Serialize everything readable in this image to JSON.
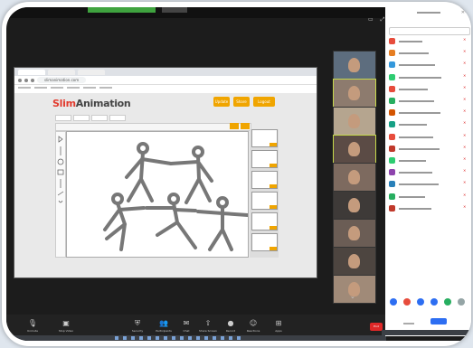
{
  "app": {
    "logo_prefix": "Slim",
    "logo_suffix": "Animation",
    "colors": {
      "accent": "#f0a500",
      "logo_red": "#e23b2e",
      "zoom_bg": "#1c1c1c",
      "end_red": "#e02828",
      "link_blue": "#2d6ef2"
    }
  },
  "browser": {
    "url": "slimanimation.com",
    "header_buttons": [
      "Update",
      "Share",
      "Logout"
    ]
  },
  "toolbar": {
    "tiny_buttons": [
      "Undo",
      "Redo"
    ]
  },
  "zoom_toolbar": {
    "buttons": [
      {
        "icon": "mic-icon",
        "glyph": "🎙",
        "label": "Unmute"
      },
      {
        "icon": "video-icon",
        "glyph": "▣",
        "label": "Stop Video"
      },
      {
        "icon": "security-icon",
        "glyph": "⛨",
        "label": "Security"
      },
      {
        "icon": "participants-icon",
        "glyph": "👥",
        "label": "Participants"
      },
      {
        "icon": "chat-icon",
        "glyph": "✉",
        "label": "Chat"
      },
      {
        "icon": "share-icon",
        "glyph": "⇧",
        "label": "Share Screen"
      },
      {
        "icon": "record-icon",
        "glyph": "●",
        "label": "Record"
      },
      {
        "icon": "reactions-icon",
        "glyph": "☺",
        "label": "Reactions"
      },
      {
        "icon": "apps-icon",
        "glyph": "⊞",
        "label": "Apps"
      }
    ],
    "end_label": "End"
  },
  "panel": {
    "participants": [
      {
        "color": "#e74c3c"
      },
      {
        "color": "#e67e22"
      },
      {
        "color": "#3498db"
      },
      {
        "color": "#2ecc71"
      },
      {
        "color": "#e74c3c"
      },
      {
        "color": "#27ae60"
      },
      {
        "color": "#d35400"
      },
      {
        "color": "#16a085"
      },
      {
        "color": "#e74c3c"
      },
      {
        "color": "#c0392b"
      },
      {
        "color": "#2ecc71"
      },
      {
        "color": "#8e44ad"
      },
      {
        "color": "#2980b9"
      },
      {
        "color": "#27ae60"
      },
      {
        "color": "#c0392b"
      }
    ],
    "bottom_buttons": [
      {
        "color": "#2d6ef2"
      },
      {
        "color": "#e74c3c"
      },
      {
        "color": "#2d6ef2"
      },
      {
        "color": "#2d6ef2"
      },
      {
        "color": "#27ae60"
      },
      {
        "color": "#95a5a6"
      }
    ]
  },
  "video_strip": {
    "tiles": [
      {
        "bg": "#5d6d7e"
      },
      {
        "bg": "#8d7b6e"
      },
      {
        "bg": "#b5a58f"
      },
      {
        "bg": "#5b4b45"
      },
      {
        "bg": "#7d6a5f"
      },
      {
        "bg": "#3e3a38"
      },
      {
        "bg": "#6b5d55"
      },
      {
        "bg": "#4d4540"
      },
      {
        "bg": "#a08a78"
      }
    ]
  }
}
